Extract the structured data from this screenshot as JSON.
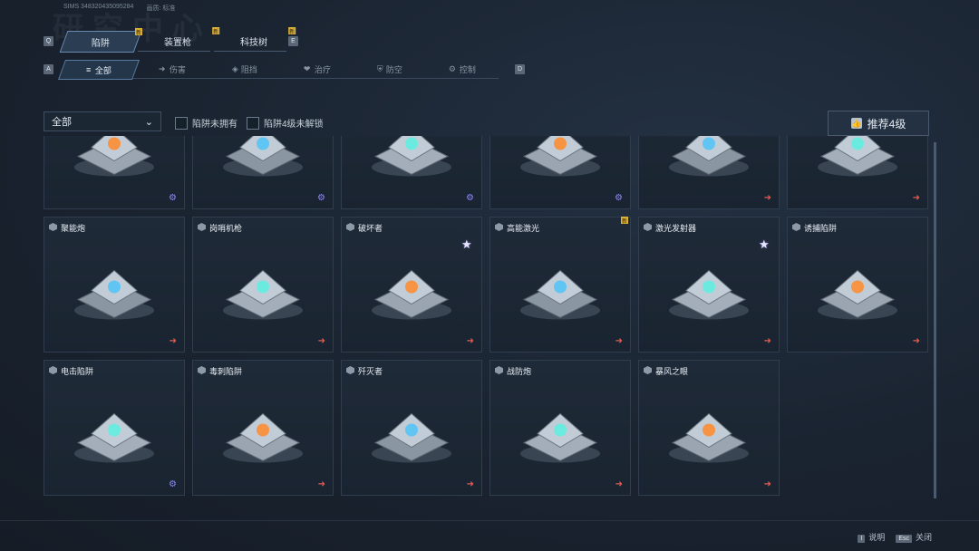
{
  "header": {
    "watermark": "研究中心",
    "id_label": "SIMS 348320435095284",
    "mode_label": "画质: 标准"
  },
  "keys": {
    "prev_tab": "Q",
    "next_tab": "E",
    "prev_sub": "A",
    "next_sub": "D"
  },
  "tabs": [
    {
      "label": "陷阱",
      "new": "新",
      "active": true
    },
    {
      "label": "装置枪",
      "new": "新",
      "active": false
    },
    {
      "label": "科技树",
      "new": "新",
      "active": false
    }
  ],
  "subtabs": [
    {
      "label": "全部",
      "icon": "≡",
      "active": true
    },
    {
      "label": "伤害",
      "icon": "➜"
    },
    {
      "label": "阻挡",
      "icon": "◈"
    },
    {
      "label": "治疗",
      "icon": "❤"
    },
    {
      "label": "防空",
      "icon": "⛨"
    },
    {
      "label": "控制",
      "icon": "⚙"
    }
  ],
  "filters": {
    "dropdown_value": "全部",
    "check1": "陷阱未拥有",
    "check2": "陷阱4级未解锁",
    "recommend": "推荐4级"
  },
  "cards_row0": [
    {
      "name": "",
      "corner": "gear"
    },
    {
      "name": "",
      "corner": "gear"
    },
    {
      "name": "",
      "corner": "gear"
    },
    {
      "name": "",
      "corner": "gear"
    },
    {
      "name": "",
      "corner": "arrow"
    },
    {
      "name": "",
      "corner": "arrow"
    }
  ],
  "cards_row1": [
    {
      "name": "聚能炮",
      "corner": "arrow"
    },
    {
      "name": "岗哨机枪",
      "corner": "arrow"
    },
    {
      "name": "破坏者",
      "corner": "arrow",
      "star": "4"
    },
    {
      "name": "高能激光",
      "corner": "arrow",
      "new": "新"
    },
    {
      "name": "激光发射器",
      "corner": "arrow",
      "star": "4"
    },
    {
      "name": "诱捕陷阱",
      "corner": "arrow"
    }
  ],
  "cards_row2": [
    {
      "name": "电击陷阱",
      "corner": "gear"
    },
    {
      "name": "毒刺陷阱",
      "corner": "arrow"
    },
    {
      "name": "歼灭者",
      "corner": "arrow"
    },
    {
      "name": "战防炮",
      "corner": "arrow"
    },
    {
      "name": "暴风之眼",
      "corner": "arrow"
    }
  ],
  "footer": {
    "help_key": "I",
    "help_label": "说明",
    "close_key": "Esc",
    "close_label": "关闭"
  },
  "colors": {
    "accent": "#6a8bb0",
    "arrow": "#e25a4f",
    "gear": "#8e8ef0",
    "new": "#e0b53a"
  }
}
